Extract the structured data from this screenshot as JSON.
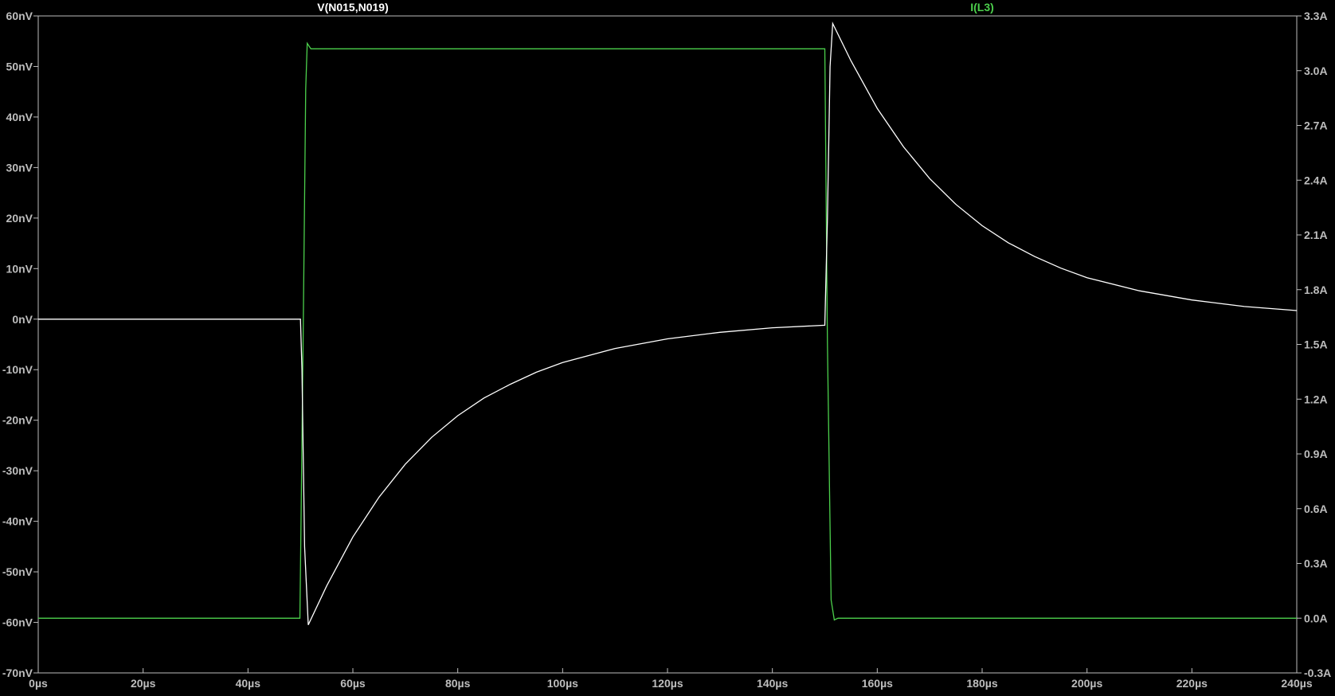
{
  "chart_data": {
    "type": "line",
    "title": "",
    "grid": false,
    "x_axis": {
      "label": "",
      "range": [
        0,
        240
      ],
      "unit": "µs",
      "ticks": [
        "0µs",
        "20µs",
        "40µs",
        "60µs",
        "80µs",
        "100µs",
        "120µs",
        "140µs",
        "160µs",
        "180µs",
        "200µs",
        "220µs",
        "240µs"
      ],
      "tick_values": [
        0,
        20,
        40,
        60,
        80,
        100,
        120,
        140,
        160,
        180,
        200,
        220,
        240
      ]
    },
    "y_left": {
      "range": [
        -70,
        60
      ],
      "unit": "nV",
      "ticks": [
        "60nV",
        "50nV",
        "40nV",
        "30nV",
        "20nV",
        "10nV",
        "0nV",
        "-10nV",
        "-20nV",
        "-30nV",
        "-40nV",
        "-50nV",
        "-60nV",
        "-70nV"
      ],
      "tick_values": [
        60,
        50,
        40,
        30,
        20,
        10,
        0,
        -10,
        -20,
        -30,
        -40,
        -50,
        -60,
        -70
      ]
    },
    "y_right": {
      "range": [
        -0.3,
        3.3
      ],
      "unit": "A",
      "ticks": [
        "3.3A",
        "3.0A",
        "2.7A",
        "2.4A",
        "2.1A",
        "1.8A",
        "1.5A",
        "1.2A",
        "0.9A",
        "0.6A",
        "0.3A",
        "0.0A",
        "-0.3A"
      ],
      "tick_values": [
        3.3,
        3.0,
        2.7,
        2.4,
        2.1,
        1.8,
        1.5,
        1.2,
        0.9,
        0.6,
        0.3,
        0.0,
        -0.3
      ]
    },
    "series": [
      {
        "name": "V(N015,N019)",
        "axis": "left",
        "color": "#ffffff",
        "points": [
          [
            0,
            0
          ],
          [
            50,
            0
          ],
          [
            50.3,
            -10
          ],
          [
            50.8,
            -45
          ],
          [
            51.5,
            -60.5
          ],
          [
            55,
            -52.8
          ],
          [
            60,
            -43.1
          ],
          [
            65,
            -35.2
          ],
          [
            70,
            -28.7
          ],
          [
            75,
            -23.4
          ],
          [
            80,
            -19.1
          ],
          [
            85,
            -15.6
          ],
          [
            90,
            -12.9
          ],
          [
            95,
            -10.5
          ],
          [
            100,
            -8.6
          ],
          [
            110,
            -5.8
          ],
          [
            120,
            -3.9
          ],
          [
            130,
            -2.6
          ],
          [
            140,
            -1.7
          ],
          [
            150,
            -1.2
          ],
          [
            150.5,
            20
          ],
          [
            151,
            50
          ],
          [
            151.5,
            58.5
          ],
          [
            155,
            51.1
          ],
          [
            160,
            41.7
          ],
          [
            165,
            34.1
          ],
          [
            170,
            27.8
          ],
          [
            175,
            22.7
          ],
          [
            180,
            18.5
          ],
          [
            185,
            15.1
          ],
          [
            190,
            12.4
          ],
          [
            195,
            10.1
          ],
          [
            200,
            8.2
          ],
          [
            210,
            5.6
          ],
          [
            220,
            3.8
          ],
          [
            230,
            2.5
          ],
          [
            240,
            1.7
          ]
        ]
      },
      {
        "name": "I(L3)",
        "axis": "right",
        "color": "#4cd04c",
        "points": [
          [
            0,
            0
          ],
          [
            49.9,
            0
          ],
          [
            50.5,
            1.5
          ],
          [
            51,
            2.9
          ],
          [
            51.3,
            3.15
          ],
          [
            52,
            3.12
          ],
          [
            150,
            3.12
          ],
          [
            150.5,
            1.5
          ],
          [
            151.2,
            0.1
          ],
          [
            151.8,
            -0.01
          ],
          [
            152.5,
            0
          ],
          [
            240,
            0
          ]
        ]
      }
    ]
  }
}
